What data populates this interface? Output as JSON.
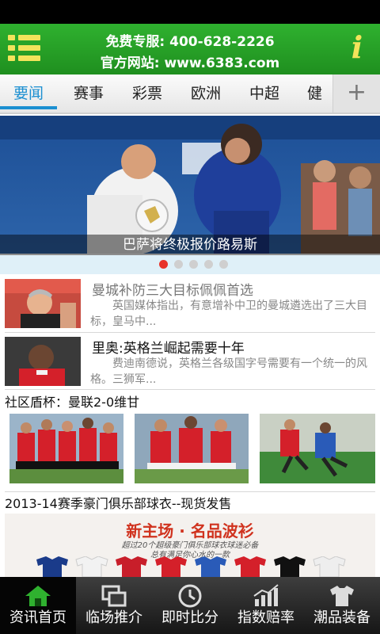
{
  "header": {
    "hotline": "免费专服: 400-628-2226",
    "website": "官方网站: www.6383.com",
    "info_icon": "i"
  },
  "tabs": [
    {
      "label": "要闻",
      "active": true
    },
    {
      "label": "赛事",
      "active": false
    },
    {
      "label": "彩票",
      "active": false
    },
    {
      "label": "欧洲",
      "active": false
    },
    {
      "label": "中超",
      "active": false
    },
    {
      "label": "健",
      "active": false
    }
  ],
  "tab_add": "+",
  "banner": {
    "caption": "巴萨将终极报价路易斯",
    "slides": 5,
    "active_slide": 1
  },
  "news": [
    {
      "title": "曼城补防三大目标佩佩首选",
      "desc": "英国媒体指出，有意增补中卫的曼城遴选出了三大目标，皇马中...",
      "read": true
    },
    {
      "title": "里奥:英格兰崛起需要十年",
      "desc": "费迪南德说，英格兰各级国字号需要有一个统一的风格。三狮军...",
      "read": false
    }
  ],
  "community": {
    "title": "社区盾杯：曼联2-0维甘"
  },
  "promo_section": {
    "title": "2013-14赛季豪门俱乐部球衣--现货发售",
    "banner_heading": "新主场 · 名品波衫",
    "banner_line1": "超过20个超级豪门俱乐部球衣球迷必备",
    "banner_line2": "总有满足你心水的一款"
  },
  "bottom_nav": [
    {
      "label": "资讯首页",
      "icon": "home-icon",
      "active": true
    },
    {
      "label": "临场推介",
      "icon": "windows-icon",
      "active": false
    },
    {
      "label": "即时比分",
      "icon": "clock-icon",
      "active": false
    },
    {
      "label": "指数赔率",
      "icon": "chart-icon",
      "active": false
    },
    {
      "label": "潮品装备",
      "icon": "shirt-icon",
      "active": false
    }
  ],
  "colors": {
    "header_green": "#2fb12f",
    "accent_yellow": "#f3e35b",
    "tab_active": "#1b8fd1",
    "dot_active": "#e8332a",
    "utd_red": "#d4202a"
  }
}
